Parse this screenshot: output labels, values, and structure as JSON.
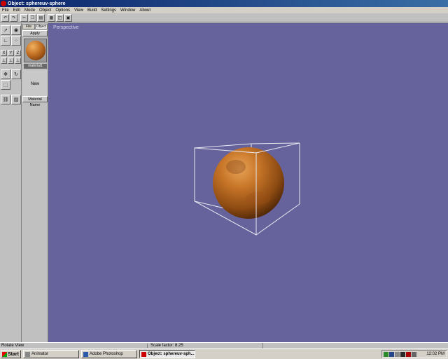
{
  "window": {
    "title": "Object: sphereuv-sphere"
  },
  "menu": [
    "File",
    "Edit",
    "Mode",
    "Object",
    "Options",
    "View",
    "Build",
    "Settings",
    "Window",
    "About"
  ],
  "toolbar": {
    "icons": [
      "undo-icon",
      "redo-icon",
      "cut-icon",
      "copy-icon",
      "paste-icon",
      "grid-icon",
      "view-icon",
      "render-icon"
    ]
  },
  "tools": {
    "axes": [
      "X",
      "Y",
      "Z"
    ]
  },
  "material_panel": {
    "tabs": [
      "File",
      "Object"
    ],
    "apply_label": "Apply",
    "material_label": "material1",
    "new_label": "New",
    "material_name_label": "Material Name"
  },
  "viewport": {
    "label": "Perspective"
  },
  "status": {
    "left": "Rotate View",
    "scale": "Scale factor: 8.25"
  },
  "taskbar": {
    "start_label": "Start",
    "tasks": [
      {
        "label": "Animator",
        "active": false
      },
      {
        "label": "Adobe Photoshop",
        "active": false
      },
      {
        "label": "Object: sphereuv-sph...",
        "active": true
      }
    ],
    "clock": "12:02 PM"
  },
  "colors": {
    "viewport_bg": "#66639c",
    "sphere": "#c87628",
    "titlebar": "#0a246a"
  }
}
